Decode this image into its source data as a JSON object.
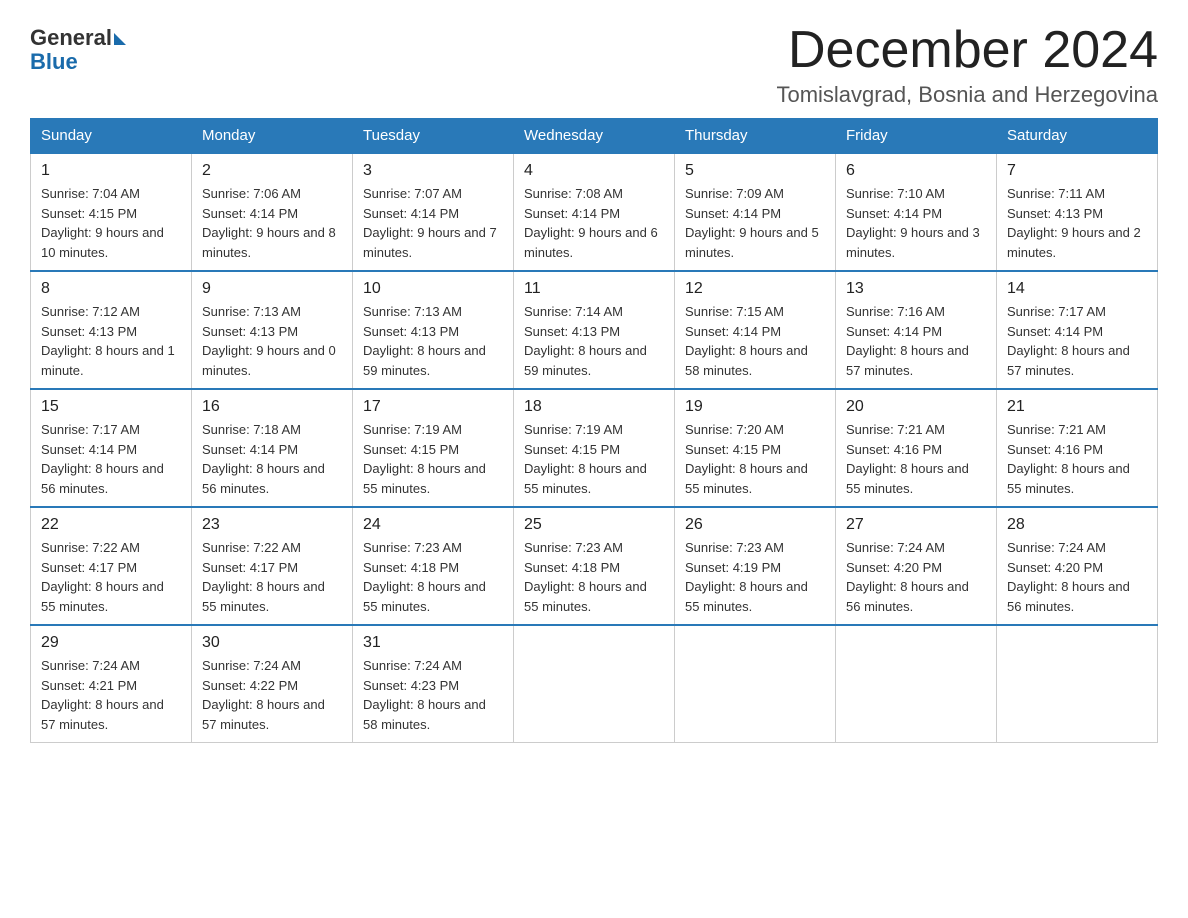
{
  "header": {
    "logo_general": "General",
    "logo_blue": "Blue",
    "month_title": "December 2024",
    "location": "Tomislavgrad, Bosnia and Herzegovina"
  },
  "weekdays": [
    "Sunday",
    "Monday",
    "Tuesday",
    "Wednesday",
    "Thursday",
    "Friday",
    "Saturday"
  ],
  "weeks": [
    [
      {
        "day": "1",
        "sunrise": "7:04 AM",
        "sunset": "4:15 PM",
        "daylight": "9 hours and 10 minutes."
      },
      {
        "day": "2",
        "sunrise": "7:06 AM",
        "sunset": "4:14 PM",
        "daylight": "9 hours and 8 minutes."
      },
      {
        "day": "3",
        "sunrise": "7:07 AM",
        "sunset": "4:14 PM",
        "daylight": "9 hours and 7 minutes."
      },
      {
        "day": "4",
        "sunrise": "7:08 AM",
        "sunset": "4:14 PM",
        "daylight": "9 hours and 6 minutes."
      },
      {
        "day": "5",
        "sunrise": "7:09 AM",
        "sunset": "4:14 PM",
        "daylight": "9 hours and 5 minutes."
      },
      {
        "day": "6",
        "sunrise": "7:10 AM",
        "sunset": "4:14 PM",
        "daylight": "9 hours and 3 minutes."
      },
      {
        "day": "7",
        "sunrise": "7:11 AM",
        "sunset": "4:13 PM",
        "daylight": "9 hours and 2 minutes."
      }
    ],
    [
      {
        "day": "8",
        "sunrise": "7:12 AM",
        "sunset": "4:13 PM",
        "daylight": "8 hours and 1 minute."
      },
      {
        "day": "9",
        "sunrise": "7:13 AM",
        "sunset": "4:13 PM",
        "daylight": "9 hours and 0 minutes."
      },
      {
        "day": "10",
        "sunrise": "7:13 AM",
        "sunset": "4:13 PM",
        "daylight": "8 hours and 59 minutes."
      },
      {
        "day": "11",
        "sunrise": "7:14 AM",
        "sunset": "4:13 PM",
        "daylight": "8 hours and 59 minutes."
      },
      {
        "day": "12",
        "sunrise": "7:15 AM",
        "sunset": "4:14 PM",
        "daylight": "8 hours and 58 minutes."
      },
      {
        "day": "13",
        "sunrise": "7:16 AM",
        "sunset": "4:14 PM",
        "daylight": "8 hours and 57 minutes."
      },
      {
        "day": "14",
        "sunrise": "7:17 AM",
        "sunset": "4:14 PM",
        "daylight": "8 hours and 57 minutes."
      }
    ],
    [
      {
        "day": "15",
        "sunrise": "7:17 AM",
        "sunset": "4:14 PM",
        "daylight": "8 hours and 56 minutes."
      },
      {
        "day": "16",
        "sunrise": "7:18 AM",
        "sunset": "4:14 PM",
        "daylight": "8 hours and 56 minutes."
      },
      {
        "day": "17",
        "sunrise": "7:19 AM",
        "sunset": "4:15 PM",
        "daylight": "8 hours and 55 minutes."
      },
      {
        "day": "18",
        "sunrise": "7:19 AM",
        "sunset": "4:15 PM",
        "daylight": "8 hours and 55 minutes."
      },
      {
        "day": "19",
        "sunrise": "7:20 AM",
        "sunset": "4:15 PM",
        "daylight": "8 hours and 55 minutes."
      },
      {
        "day": "20",
        "sunrise": "7:21 AM",
        "sunset": "4:16 PM",
        "daylight": "8 hours and 55 minutes."
      },
      {
        "day": "21",
        "sunrise": "7:21 AM",
        "sunset": "4:16 PM",
        "daylight": "8 hours and 55 minutes."
      }
    ],
    [
      {
        "day": "22",
        "sunrise": "7:22 AM",
        "sunset": "4:17 PM",
        "daylight": "8 hours and 55 minutes."
      },
      {
        "day": "23",
        "sunrise": "7:22 AM",
        "sunset": "4:17 PM",
        "daylight": "8 hours and 55 minutes."
      },
      {
        "day": "24",
        "sunrise": "7:23 AM",
        "sunset": "4:18 PM",
        "daylight": "8 hours and 55 minutes."
      },
      {
        "day": "25",
        "sunrise": "7:23 AM",
        "sunset": "4:18 PM",
        "daylight": "8 hours and 55 minutes."
      },
      {
        "day": "26",
        "sunrise": "7:23 AM",
        "sunset": "4:19 PM",
        "daylight": "8 hours and 55 minutes."
      },
      {
        "day": "27",
        "sunrise": "7:24 AM",
        "sunset": "4:20 PM",
        "daylight": "8 hours and 56 minutes."
      },
      {
        "day": "28",
        "sunrise": "7:24 AM",
        "sunset": "4:20 PM",
        "daylight": "8 hours and 56 minutes."
      }
    ],
    [
      {
        "day": "29",
        "sunrise": "7:24 AM",
        "sunset": "4:21 PM",
        "daylight": "8 hours and 57 minutes."
      },
      {
        "day": "30",
        "sunrise": "7:24 AM",
        "sunset": "4:22 PM",
        "daylight": "8 hours and 57 minutes."
      },
      {
        "day": "31",
        "sunrise": "7:24 AM",
        "sunset": "4:23 PM",
        "daylight": "8 hours and 58 minutes."
      },
      null,
      null,
      null,
      null
    ]
  ],
  "labels": {
    "sunrise": "Sunrise:",
    "sunset": "Sunset:",
    "daylight": "Daylight:"
  }
}
